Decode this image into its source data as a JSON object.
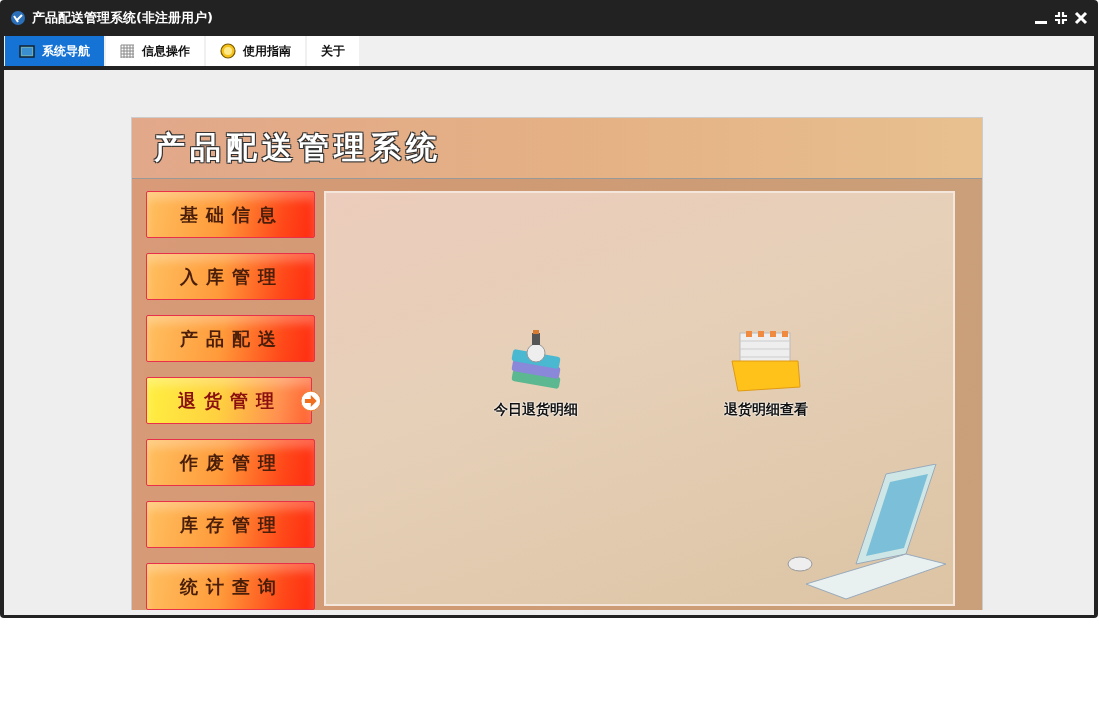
{
  "window": {
    "title": "产品配送管理系统(非注册用户)"
  },
  "tabs": [
    {
      "label": "系统导航",
      "kind": "monitor",
      "selected": true
    },
    {
      "label": "信息操作",
      "kind": "grid",
      "selected": false
    },
    {
      "label": "使用指南",
      "kind": "help",
      "selected": false
    },
    {
      "label": "关于",
      "kind": "none",
      "selected": false
    }
  ],
  "app": {
    "title": "产品配送管理系统"
  },
  "menu": [
    {
      "label": "基础信息",
      "selected": false
    },
    {
      "label": "入库管理",
      "selected": false
    },
    {
      "label": "产品配送",
      "selected": false
    },
    {
      "label": "退货管理",
      "selected": true
    },
    {
      "label": "作废管理",
      "selected": false
    },
    {
      "label": "库存管理",
      "selected": false
    },
    {
      "label": "统计查询",
      "selected": false
    }
  ],
  "shortcuts": [
    {
      "label": "今日退货明细",
      "kind": "books"
    },
    {
      "label": "退货明细查看",
      "kind": "files"
    }
  ]
}
